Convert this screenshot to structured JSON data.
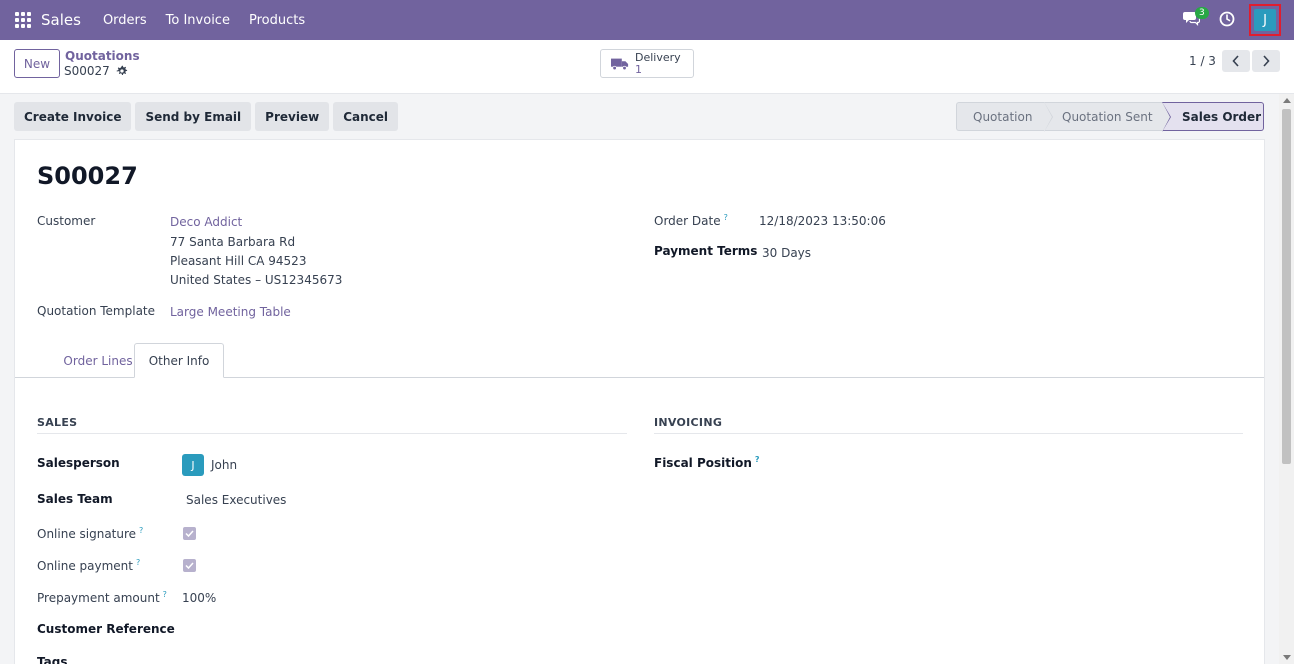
{
  "topnav": {
    "app_name": "Sales",
    "menu": [
      "Orders",
      "To Invoice",
      "Products"
    ],
    "chat_count": "3",
    "user_initial": "J"
  },
  "control": {
    "new_label": "New",
    "breadcrumb_parent": "Quotations",
    "breadcrumb_current": "S00027",
    "delivery_label": "Delivery",
    "delivery_count": "1",
    "pager": "1 / 3"
  },
  "actions": [
    "Create Invoice",
    "Send by Email",
    "Preview",
    "Cancel"
  ],
  "statusbar": [
    "Quotation",
    "Quotation Sent",
    "Sales Order"
  ],
  "form": {
    "name": "S00027",
    "customer_label": "Customer",
    "customer_name": "Deco Addict",
    "customer_address": [
      "77 Santa Barbara Rd",
      "Pleasant Hill CA 94523",
      "United States – US12345673"
    ],
    "template_label": "Quotation Template",
    "template_value": "Large Meeting Table",
    "order_date_label": "Order Date",
    "order_date_value": "12/18/2023 13:50:06",
    "payment_terms_label": "Payment Terms",
    "payment_terms_value": "30 Days"
  },
  "tabs": [
    "Order Lines",
    "Other Info"
  ],
  "other_info": {
    "sales_heading": "SALES",
    "invoicing_heading": "INVOICING",
    "salesperson_label": "Salesperson",
    "salesperson_initial": "J",
    "salesperson_name": "John",
    "sales_team_label": "Sales Team",
    "sales_team_value": "Sales Executives",
    "online_signature_label": "Online signature",
    "online_payment_label": "Online payment",
    "prepayment_label": "Prepayment amount",
    "prepayment_value": "100%",
    "customer_reference_label": "Customer Reference",
    "tags_label": "Tags",
    "fiscal_position_label": "Fiscal Position",
    "help_mark": "?"
  }
}
